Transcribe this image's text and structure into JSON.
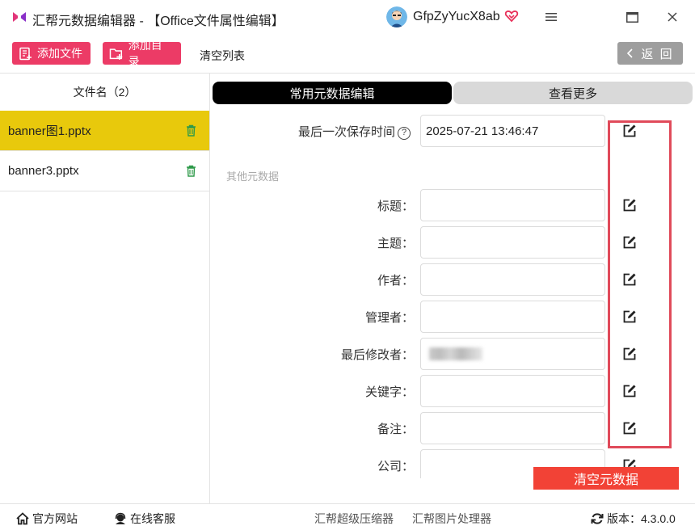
{
  "window": {
    "title": "汇帮元数据编辑器 - 【Office文件属性编辑】",
    "username": "GfpZyYucX8ab",
    "icons": [
      "app-logo-icon",
      "avatar-icon",
      "vip-heart-icon",
      "menu-icon",
      "maximize-icon",
      "close-icon"
    ]
  },
  "toolbar": {
    "add_file": "添加文件",
    "add_folder": "添加目录",
    "clear_list": "清空列表",
    "back": "返 回"
  },
  "file_list": {
    "header": "文件名（2）",
    "files": [
      {
        "name": "banner图1.pptx",
        "selected": true
      },
      {
        "name": "banner3.pptx",
        "selected": false
      }
    ]
  },
  "tabs": {
    "common": "常用元数据编辑",
    "more": "查看更多",
    "active": "common"
  },
  "form": {
    "last_saved": {
      "label": "最后一次保存时间",
      "value": "2025-07-21 13:46:47"
    },
    "section_other": "其他元数据",
    "fields": [
      {
        "label": "标题：",
        "value": ""
      },
      {
        "label": "主题：",
        "value": ""
      },
      {
        "label": "作者：",
        "value": ""
      },
      {
        "label": "管理者：",
        "value": ""
      },
      {
        "label": "最后修改者：",
        "value": "",
        "redacted": true
      },
      {
        "label": "关键字：",
        "value": ""
      },
      {
        "label": "备注：",
        "value": ""
      },
      {
        "label": "公司：",
        "value": ""
      }
    ],
    "clear_metadata": "清空元数据"
  },
  "footer": {
    "website": "官方网站",
    "support": "在线客服",
    "compressor": "汇帮超级压缩器",
    "image_tool": "汇帮图片处理器",
    "version_label": "版本：",
    "version": "4.3.0.0"
  },
  "colors": {
    "accent_pink": "#ec3b66",
    "selected_yellow": "#e8c90c",
    "danger_red": "#f24236",
    "highlight_border": "#e04a5a"
  }
}
